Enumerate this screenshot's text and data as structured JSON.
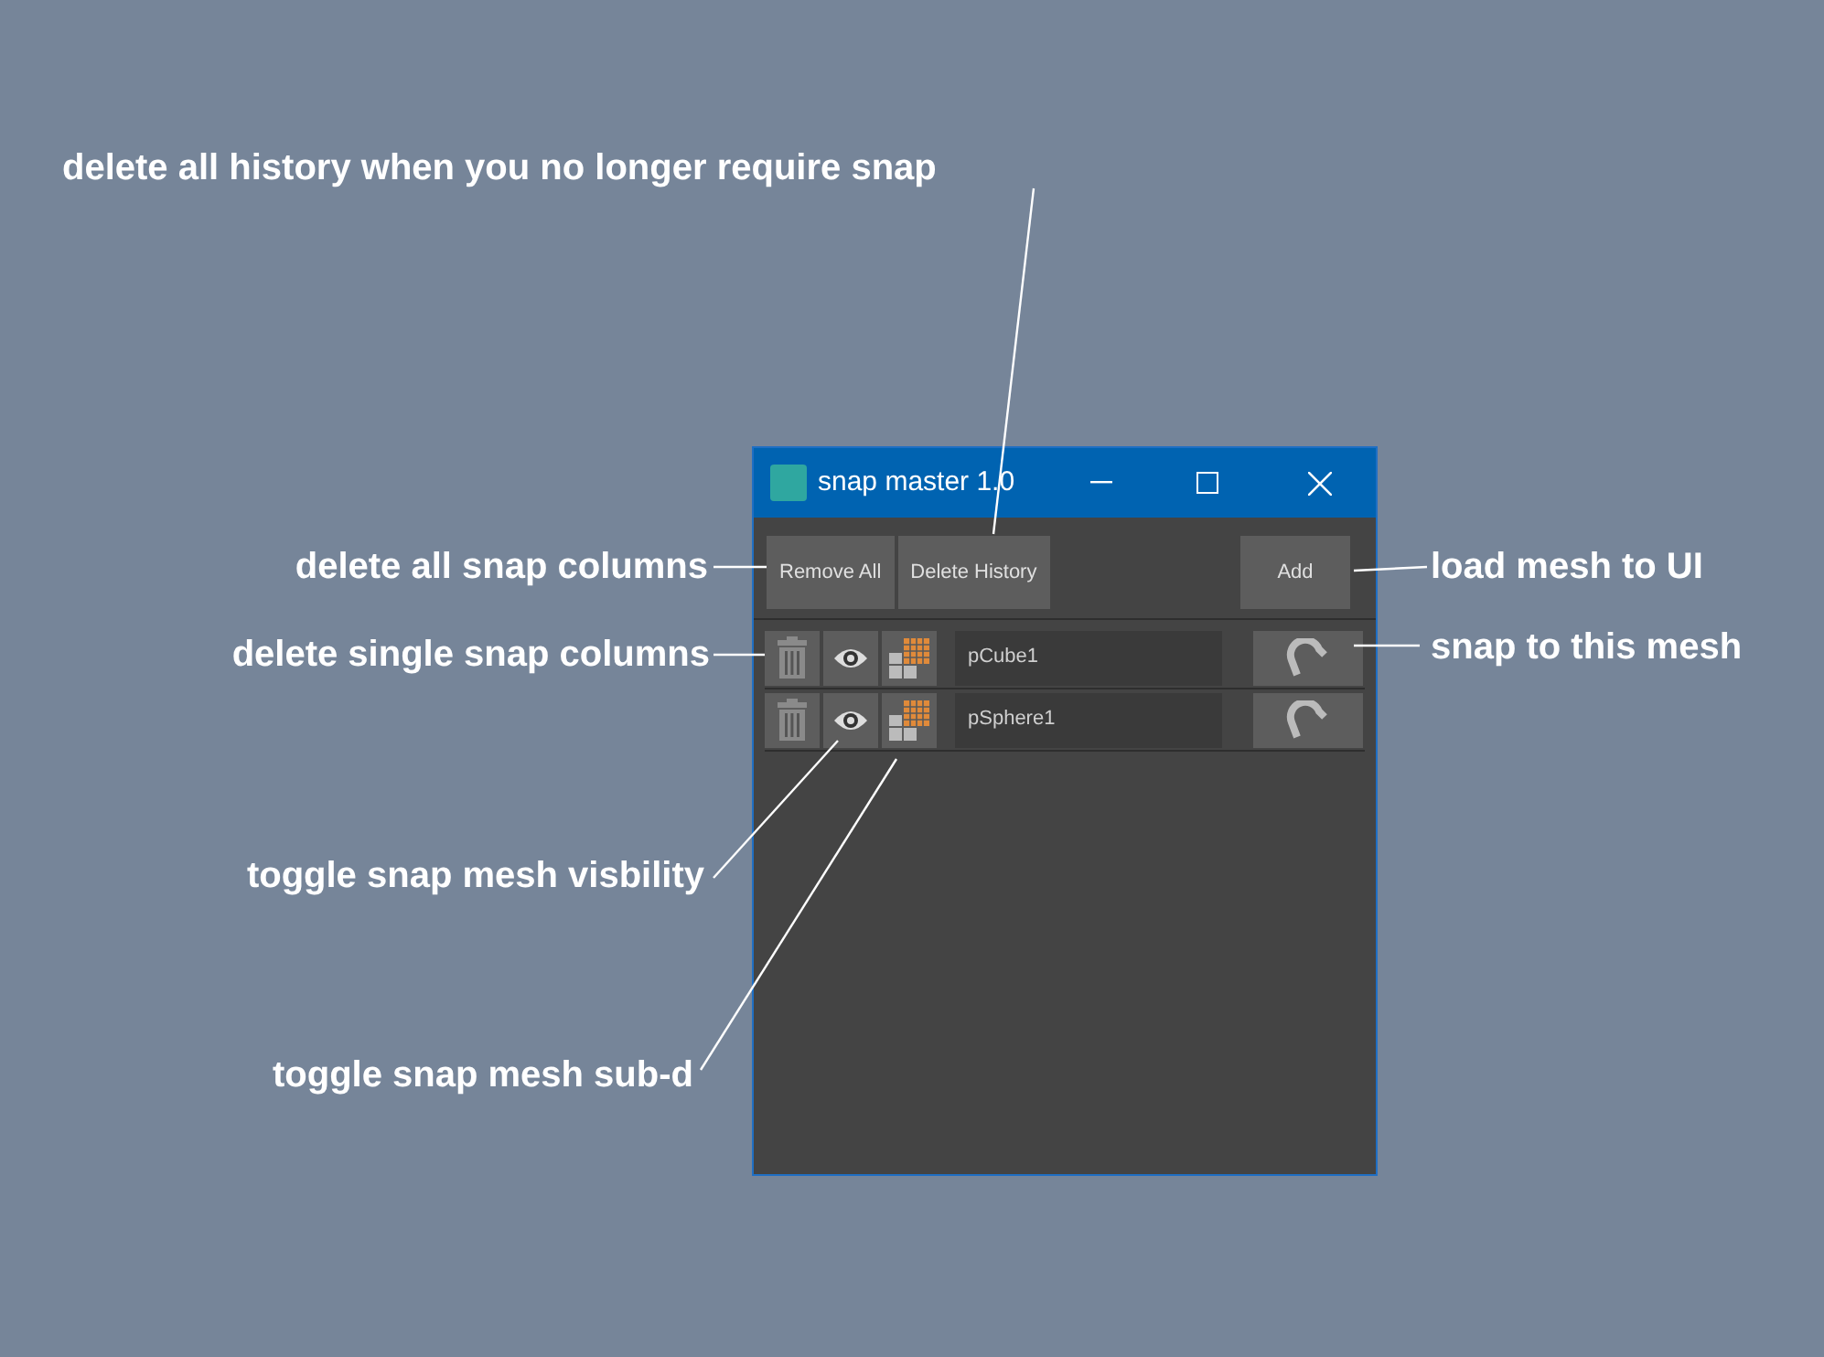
{
  "window": {
    "title": "snap master 1.0"
  },
  "toolbar": {
    "left_buttons": [
      "Remove All",
      "Delete History"
    ],
    "right_button": "Add"
  },
  "rows": [
    {
      "name": "pCube1"
    },
    {
      "name": "pSphere1"
    }
  ],
  "annotations": [
    "delete all history when you no longer require snap",
    "delete all snap columns",
    "load mesh to UI",
    "delete single snap columns",
    "snap to this mesh",
    "toggle snap mesh visbility",
    "toggle snap mesh sub-d"
  ]
}
